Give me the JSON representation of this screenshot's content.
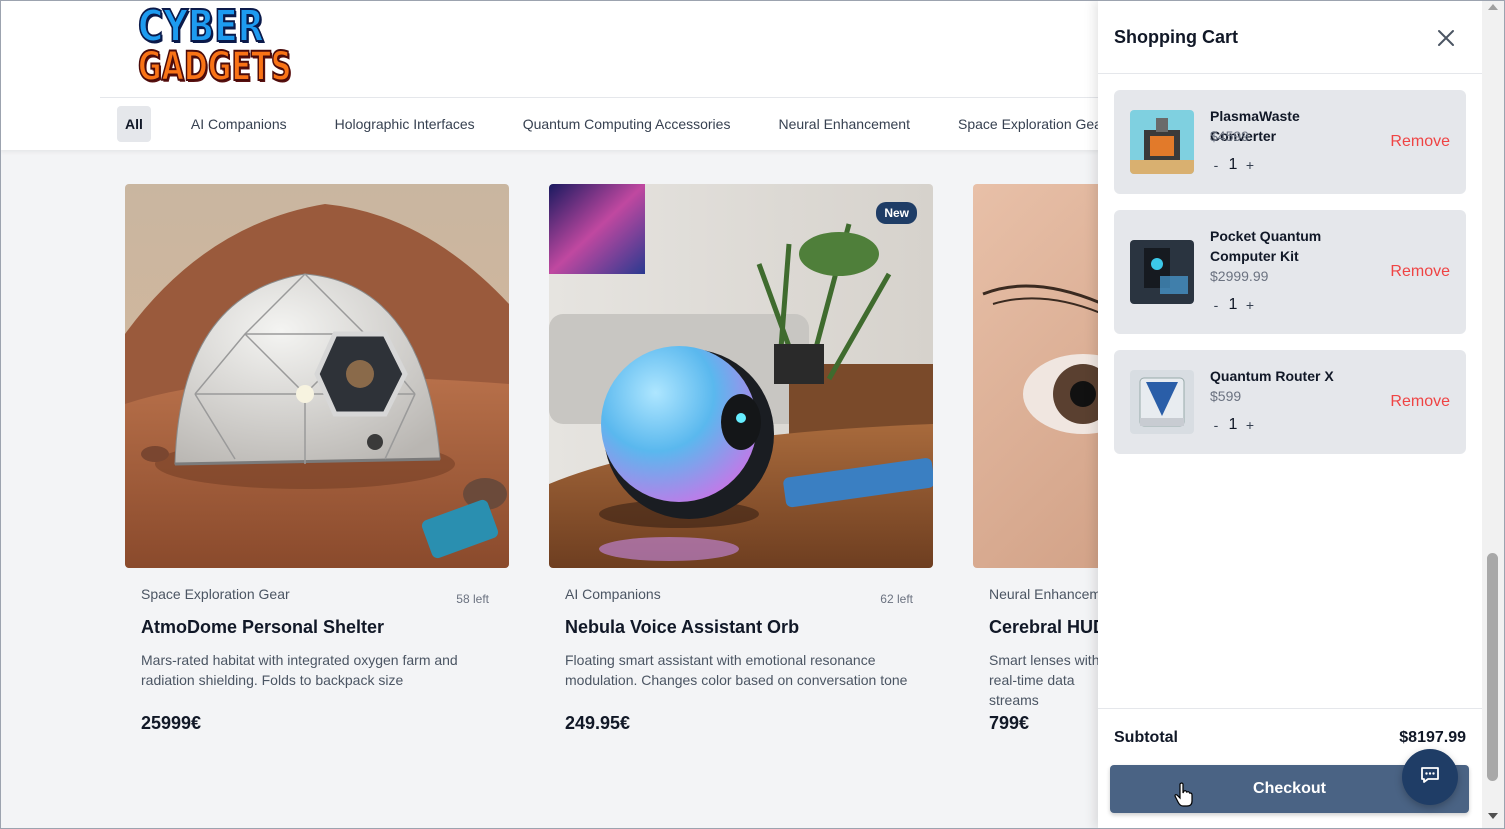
{
  "brand": {
    "line1": "CYBER",
    "line2": "GADGETS"
  },
  "categories": [
    {
      "label": "All",
      "active": true
    },
    {
      "label": "AI Companions"
    },
    {
      "label": "Holographic Interfaces"
    },
    {
      "label": "Quantum Computing Accessories"
    },
    {
      "label": "Neural Enhancement"
    },
    {
      "label": "Space Exploration Gear"
    }
  ],
  "products": [
    {
      "category": "Space Exploration Gear",
      "stock": "58 left",
      "title": "AtmoDome Personal Shelter",
      "description": "Mars-rated habitat with integrated oxygen farm and radiation shielding. Folds to backpack size",
      "price": "25999€"
    },
    {
      "category": "AI Companions",
      "stock": "62 left",
      "title": "Nebula Voice Assistant Orb",
      "description": "Floating smart assistant with emotional resonance modulation. Changes color based on conversation tone",
      "price": "249.95€",
      "badge": "New"
    },
    {
      "category": "Neural Enhancement",
      "title": "Cerebral HUD",
      "description": "Smart lenses with real-time data streams",
      "price": "799€"
    }
  ],
  "cart": {
    "title": "Shopping Cart",
    "remove_label": "Remove",
    "items": [
      {
        "name": "PlasmaWaste Converter",
        "price": "$4599",
        "qty": "1"
      },
      {
        "name": "Pocket Quantum Computer Kit",
        "price": "$2999.99",
        "qty": "1"
      },
      {
        "name": "Quantum Router X",
        "price": "$599",
        "qty": "1"
      }
    ],
    "qty_minus": "-",
    "qty_plus": "+",
    "subtotal_label": "Subtotal",
    "subtotal_value": "$8197.99",
    "checkout_label": "Checkout"
  },
  "colors": {
    "accent": "#4a6384",
    "remove": "#ef4444",
    "badge": "#1f3d66"
  },
  "icons": {
    "close": "close-icon",
    "chat": "chat-bubble-icon"
  }
}
